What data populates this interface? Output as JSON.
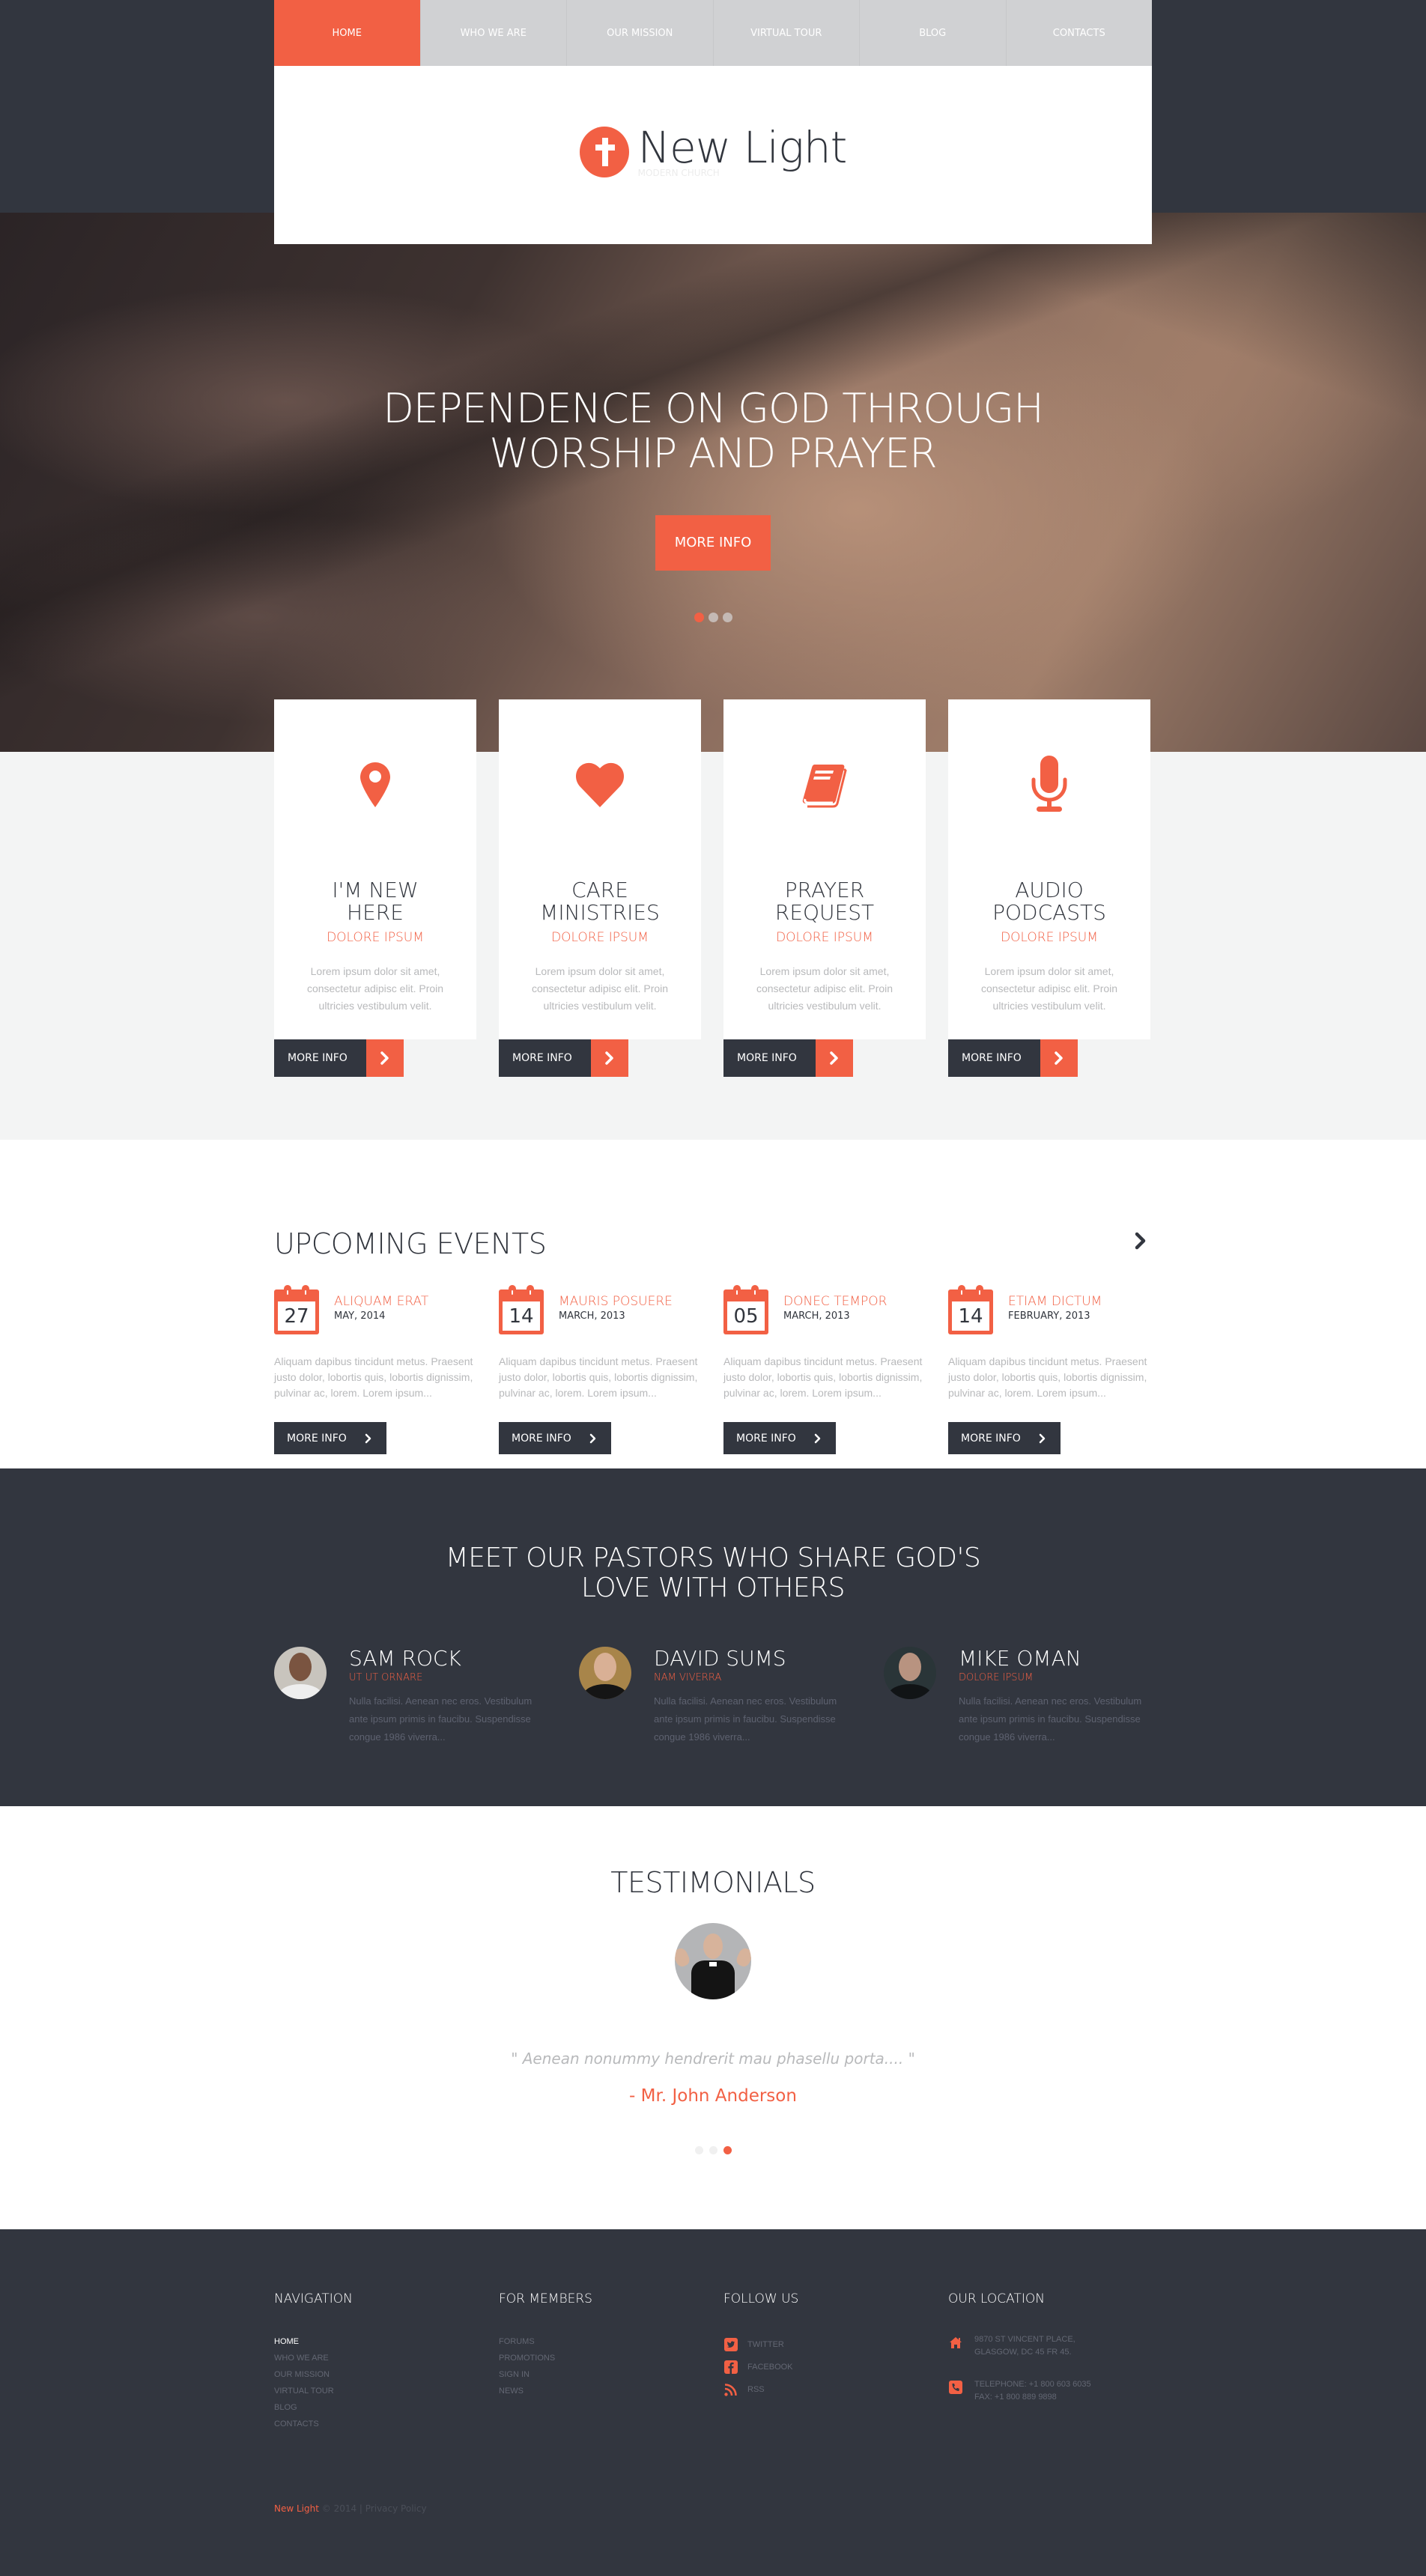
{
  "colors": {
    "accent": "#f26044",
    "dark": "#32363f",
    "light_gray": "#f3f4f4",
    "nav_gray": "#d0d1d3"
  },
  "nav": {
    "items": [
      {
        "label": "HOME",
        "active": true
      },
      {
        "label": "WHO WE ARE",
        "active": false
      },
      {
        "label": "OUR MISSION",
        "active": false
      },
      {
        "label": "VIRTUAL TOUR",
        "active": false
      },
      {
        "label": "BLOG",
        "active": false
      },
      {
        "label": "CONTACTS",
        "active": false
      }
    ]
  },
  "logo": {
    "icon": "cross-icon",
    "name": "New Light",
    "tagline": "MODERN CHURCH"
  },
  "hero": {
    "heading_line1": "DEPENDENCE ON GOD THROUGH",
    "heading_line2": "WORSHIP AND PRAYER",
    "button": "MORE INFO",
    "slides": 3,
    "active_slide": 1
  },
  "services": [
    {
      "icon": "map-pin-icon",
      "title_line1": "I'M NEW",
      "title_line2": "HERE",
      "subtitle": "DOLORE IPSUM",
      "text": "Lorem ipsum dolor sit amet, consectetur adipisc elit. Proin ultricies vestibulum velit.",
      "button": "MORE INFO"
    },
    {
      "icon": "heart-icon",
      "title_line1": "CARE",
      "title_line2": "MINISTRIES",
      "subtitle": "DOLORE IPSUM",
      "text": "Lorem ipsum dolor sit amet, consectetur adipisc elit. Proin ultricies vestibulum velit.",
      "button": "MORE INFO"
    },
    {
      "icon": "book-icon",
      "title_line1": "PRAYER",
      "title_line2": "REQUEST",
      "subtitle": "DOLORE IPSUM",
      "text": "Lorem ipsum dolor sit amet, consectetur adipisc elit. Proin ultricies vestibulum velit.",
      "button": "MORE INFO"
    },
    {
      "icon": "microphone-icon",
      "title_line1": "AUDIO",
      "title_line2": "PODCASTS",
      "subtitle": "DOLORE IPSUM",
      "text": "Lorem ipsum dolor sit amet, consectetur adipisc elit. Proin ultricies vestibulum velit.",
      "button": "MORE INFO"
    }
  ],
  "events": {
    "title": "UPCOMING EVENTS",
    "items": [
      {
        "day": "27",
        "name": "ALIQUAM ERAT",
        "date": "MAY, 2014",
        "text": "Aliquam dapibus tincidunt metus. Praesent justo dolor, lobortis quis, lobortis dignissim, pulvinar ac, lorem. Lorem ipsum...",
        "button": "MORE INFO"
      },
      {
        "day": "14",
        "name": "MAURIS POSUERE",
        "date": "MARCH, 2013",
        "text": "Aliquam dapibus tincidunt metus. Praesent justo dolor, lobortis quis, lobortis dignissim, pulvinar ac, lorem. Lorem ipsum...",
        "button": "MORE INFO"
      },
      {
        "day": "05",
        "name": "DONEC TEMPOR",
        "date": "MARCH, 2013",
        "text": "Aliquam dapibus tincidunt metus. Praesent justo dolor, lobortis quis, lobortis dignissim, pulvinar ac, lorem. Lorem ipsum...",
        "button": "MORE INFO"
      },
      {
        "day": "14",
        "name": "ETIAM DICTUM",
        "date": "FEBRUARY, 2013",
        "text": "Aliquam dapibus tincidunt metus. Praesent justo dolor, lobortis quis, lobortis dignissim, pulvinar ac, lorem. Lorem ipsum...",
        "button": "MORE INFO"
      }
    ]
  },
  "pastors": {
    "title_line1": "MEET OUR PASTORS WHO SHARE GOD'S",
    "title_line2": "LOVE WITH OTHERS",
    "items": [
      {
        "name": "SAM ROCK",
        "role": "UT UT ORNARE",
        "text": "Nulla facilisi. Aenean nec eros. Vestibulum ante ipsum primis in faucibu. Suspendisse congue 1986 viverra..."
      },
      {
        "name": "DAVID SUMS",
        "role": "NAM VIVERRA",
        "text": "Nulla facilisi. Aenean nec eros. Vestibulum ante ipsum primis in faucibu. Suspendisse congue 1986 viverra..."
      },
      {
        "name": "MIKE OMAN",
        "role": "DOLORE IPSUM",
        "text": "Nulla facilisi. Aenean nec eros. Vestibulum ante ipsum primis in faucibu. Suspendisse congue 1986 viverra..."
      }
    ]
  },
  "testimonials": {
    "title": "TESTIMONIALS",
    "quote": "\" Aenean nonummy hendrerit mau phasellu porta.... \"",
    "author": "- Mr. John Anderson",
    "slides": 3,
    "active_slide": 3
  },
  "footer": {
    "navigation": {
      "title": "NAVIGATION",
      "links": [
        "HOME",
        "WHO WE ARE",
        "OUR MISSION",
        "VIRTUAL TOUR",
        "BLOG",
        "CONTACTS"
      ]
    },
    "members": {
      "title": "FOR MEMBERS",
      "links": [
        "FORUMS",
        "PROMOTIONS",
        "SIGN IN",
        "NEWS"
      ]
    },
    "follow": {
      "title": "FOLLOW US",
      "links": [
        {
          "icon": "twitter-icon",
          "label": "TWITTER"
        },
        {
          "icon": "facebook-icon",
          "label": "FACEBOOK"
        },
        {
          "icon": "rss-icon",
          "label": "RSS"
        }
      ]
    },
    "location": {
      "title": "OUR LOCATION",
      "address_line1": "9870 ST VINCENT PLACE,",
      "address_line2": "GLASGOW, DC 45 FR 45.",
      "telephone": "TELEPHONE: +1 800 603 6035",
      "fax": "FAX: +1 800 889 9898"
    },
    "copyright": {
      "brand": "New Light",
      "text": " © 2014 | ",
      "privacy": "Privacy Policy"
    }
  }
}
